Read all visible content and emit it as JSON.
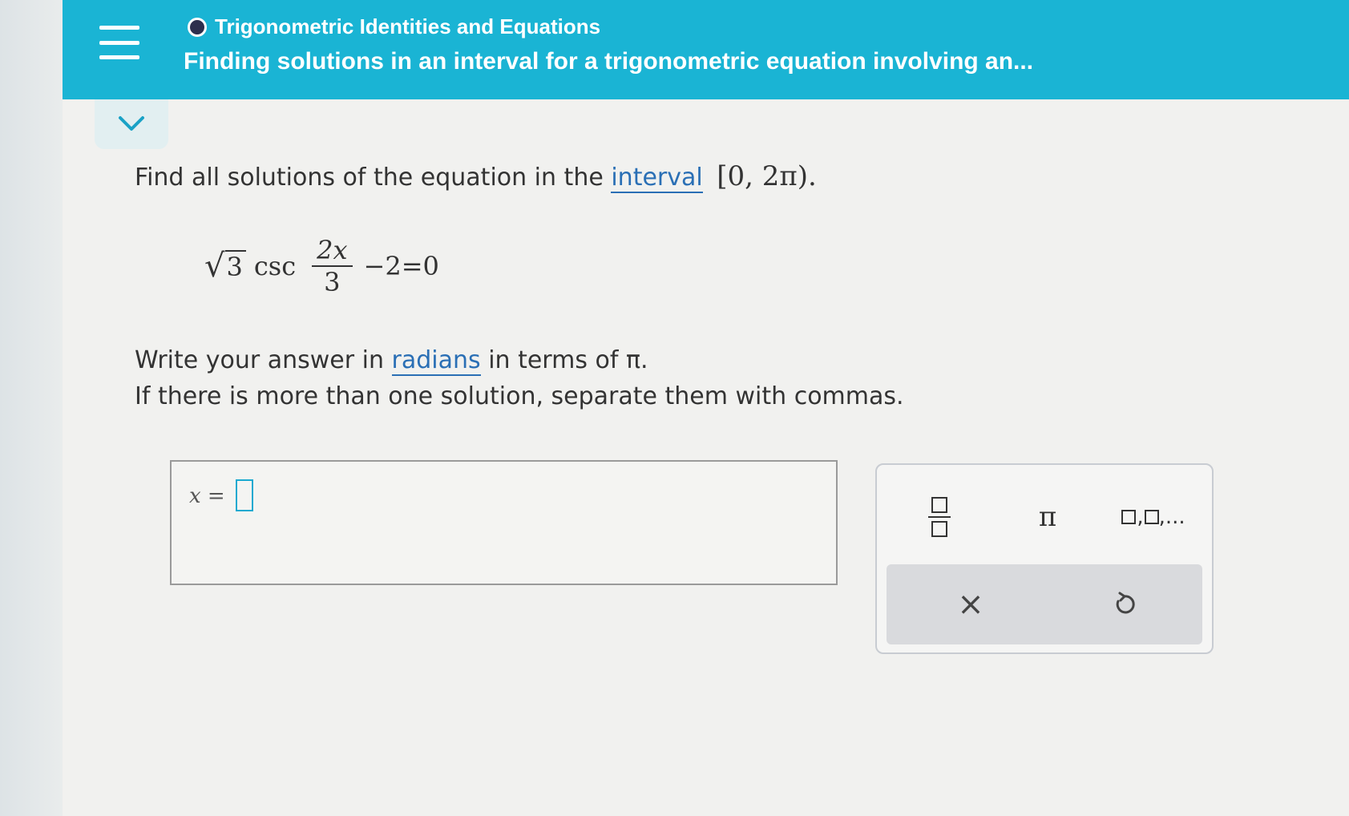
{
  "header": {
    "topic": "Trigonometric Identities and Equations",
    "title": "Finding solutions in an interval for a trigonometric equation involving an..."
  },
  "question": {
    "prompt_prefix": "Find all solutions of the equation in the",
    "prompt_link": "interval",
    "interval": "[0, 2π).",
    "equation": {
      "radicand": "3",
      "function": "csc",
      "numerator": "2x",
      "denominator": "3",
      "rest": "−2=0"
    },
    "instruction1_prefix": "Write your answer in",
    "instruction1_link": "radians",
    "instruction1_suffix": "in terms of π.",
    "instruction2": "If there is more than one solution, separate them with commas."
  },
  "answer": {
    "label": "x =",
    "value": ""
  },
  "keypad": {
    "pi": "π",
    "list_suffix": ",...",
    "clear": "×"
  },
  "colors": {
    "header_bg": "#1ab4d4",
    "link": "#2a6fb5",
    "input_border": "#1aa9d0"
  }
}
